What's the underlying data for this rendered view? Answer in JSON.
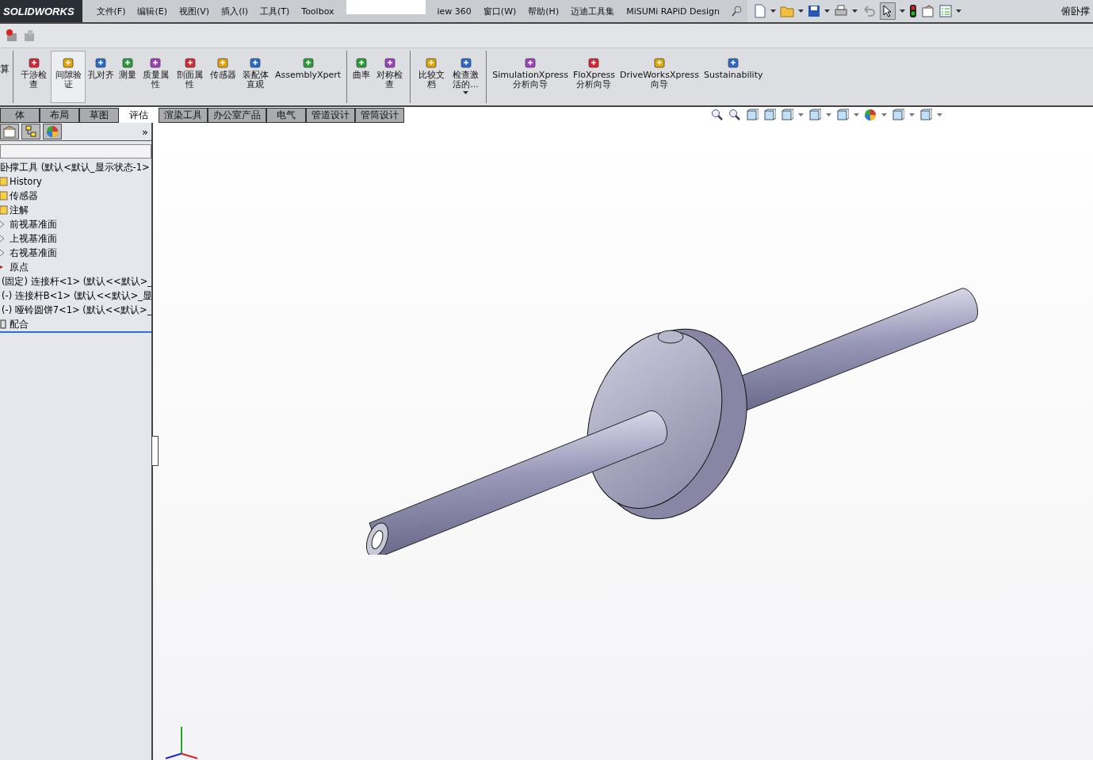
{
  "app": {
    "logo": "SOLIDWORKS",
    "document_title": "俯卧撑"
  },
  "menu": [
    {
      "label": "文件(F)"
    },
    {
      "label": "编辑(E)"
    },
    {
      "label": "视图(V)"
    },
    {
      "label": "插入(I)"
    },
    {
      "label": "工具(T)"
    },
    {
      "label": "Toolbox"
    },
    {
      "label": "iew 360"
    },
    {
      "label": "窗口(W)"
    },
    {
      "label": "帮助(H)"
    },
    {
      "label": "迈迪工具集"
    },
    {
      "label": "MiSUMi RAPiD Design"
    }
  ],
  "ribbon": {
    "cut_label": "算",
    "groups": [
      [
        {
          "label": "干涉检查",
          "selected": false,
          "dropdown": false
        },
        {
          "label": "间隙验证",
          "selected": true,
          "dropdown": false
        },
        {
          "label": "孔对齐",
          "selected": false,
          "dropdown": false
        },
        {
          "label": "测量",
          "selected": false,
          "dropdown": false
        },
        {
          "label": "质量属性",
          "selected": false,
          "dropdown": false
        },
        {
          "label": "剖面属性",
          "selected": false,
          "dropdown": false
        },
        {
          "label": "传感器",
          "selected": false,
          "dropdown": false
        },
        {
          "label": "装配体直观",
          "selected": false,
          "dropdown": false
        },
        {
          "label": "AssemblyXpert",
          "selected": false,
          "dropdown": false
        }
      ],
      [
        {
          "label": "曲率",
          "selected": false,
          "dropdown": false
        },
        {
          "label": "对称检查",
          "selected": false,
          "dropdown": false
        }
      ],
      [
        {
          "label": "比较文档",
          "selected": false,
          "dropdown": false
        },
        {
          "label": "检查激活的...",
          "selected": false,
          "dropdown": true
        }
      ],
      [
        {
          "label": "SimulationXpress 分析向导",
          "selected": false,
          "dropdown": false
        },
        {
          "label": "FloXpress 分析向导",
          "selected": false,
          "dropdown": false
        },
        {
          "label": "DriveWorksXpress 向导",
          "selected": false,
          "dropdown": false
        },
        {
          "label": "Sustainability",
          "selected": false,
          "dropdown": false
        }
      ]
    ]
  },
  "tabs": [
    {
      "label": "体",
      "selected": false
    },
    {
      "label": "布局",
      "selected": false
    },
    {
      "label": "草图",
      "selected": false
    },
    {
      "label": "评估",
      "selected": true
    },
    {
      "label": "渲染工具",
      "selected": false
    },
    {
      "label": "办公室产品",
      "selected": false
    },
    {
      "label": "电气",
      "selected": false
    },
    {
      "label": "管道设计",
      "selected": false
    },
    {
      "label": "管筒设计",
      "selected": false
    }
  ],
  "panel": {
    "expand": "»",
    "tree": [
      {
        "label": "卧撑工具  (默认<默认_显示状态-1>",
        "kind": "root",
        "selected": false
      },
      {
        "label": "History",
        "kind": "folder",
        "selected": false
      },
      {
        "label": "传感器",
        "kind": "folder",
        "selected": false
      },
      {
        "label": "注解",
        "kind": "folder",
        "selected": false
      },
      {
        "label": "前视基准面",
        "kind": "plane",
        "selected": false
      },
      {
        "label": "上视基准面",
        "kind": "plane",
        "selected": false
      },
      {
        "label": "右视基准面",
        "kind": "plane",
        "selected": false
      },
      {
        "label": "原点",
        "kind": "origin",
        "selected": false
      },
      {
        "label": "(固定) 连接杆<1> (默认<<默认>_",
        "kind": "part",
        "selected": false
      },
      {
        "label": "(-) 连接杆B<1> (默认<<默认>_显",
        "kind": "part",
        "selected": false
      },
      {
        "label": "(-) 哑铃圆饼7<1> (默认<<默认>_",
        "kind": "part",
        "selected": false
      },
      {
        "label": "配合",
        "kind": "mates",
        "selected": true
      }
    ]
  }
}
